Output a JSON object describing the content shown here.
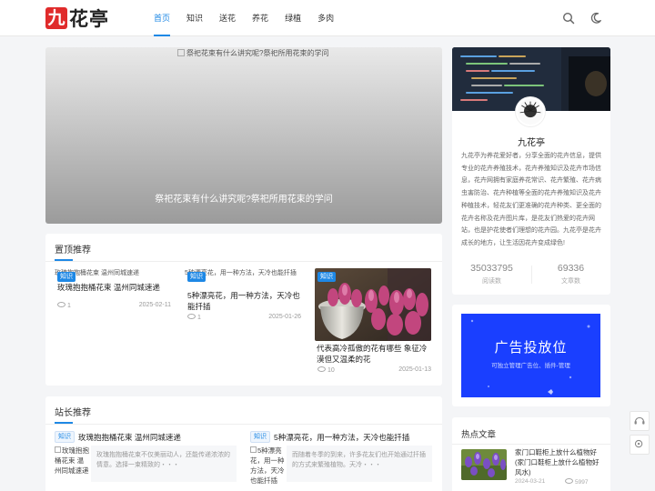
{
  "header": {
    "logo_mark": "九",
    "logo_text": "花亭",
    "nav": [
      "首页",
      "知识",
      "送花",
      "养花",
      "绿植",
      "多肉"
    ],
    "active_nav": 0,
    "icons": [
      "search-icon",
      "moon-icon"
    ]
  },
  "slider": {
    "alt": "祭祀花束有什么讲究呢?祭祀所用花束的学问",
    "title": "祭祀花束有什么讲究呢?祭祀所用花束的学问"
  },
  "top_picks": {
    "title": "置顶推荐",
    "items": [
      {
        "alt": "玫瑰抱抱桶花束 温州同城速递",
        "tag": "知识",
        "title": "玫瑰抱抱桶花束 温州同城速递",
        "views": "1",
        "date": "2025-02-11"
      },
      {
        "alt": "5种漂亮花，用一种方法，天冷也能扦插",
        "tag": "知识",
        "title": "5种漂亮花，用一种方法，天冷也能扦插",
        "views": "1",
        "date": "2025-01-26"
      },
      {
        "tag": "知识",
        "title": "代表高冷孤傲的花有哪些 象征冷漠但又温柔的花",
        "views": "10",
        "date": "2025-01-13"
      }
    ]
  },
  "site_picks": {
    "title": "站长推荐",
    "items": [
      {
        "tag": "知识",
        "title": "玫瑰抱抱桶花束 温州同城速递",
        "thumb_alt": "玫瑰抱抱桶花束 温州同城速递",
        "desc": "玫瑰抱抱桶花束不仅美丽动人，还能传递浓浓的情意。选择一束精致的・・・"
      },
      {
        "tag": "知识",
        "title": "5种漂亮花，用一种方法，天冷也能扦插",
        "thumb_alt": "5种漂亮花，用一种方法，天冷也能扦插",
        "desc": "而随着冬季的到来，许多花友们也开始通过扦插的方式来繁殖植物。天冷・・・"
      }
    ]
  },
  "profile": {
    "name": "九花亭",
    "desc": "九花亭为养花爱好者，分享全面的花卉信息，提供专业的花卉养殖技术，花卉养殖知识及花卉市场信息，花卉网拥有家庭养花常识、花卉繁殖、花卉病虫害防治、花卉种植等全面的花卉养殖知识及花卉种植技术，轻花友们更准确的花卉种类、更全面的花卉名称及花卉图片库，是花友们热爱的花卉网站，也是护花使者们理想的花卉园。九花亭是花卉成长的地方，让生活因花卉变成绿色!",
    "stats": [
      {
        "value": "35033795",
        "label": "阅读数"
      },
      {
        "value": "69336",
        "label": "文章数"
      }
    ]
  },
  "ad": {
    "title": "广告投放位",
    "sub": "可独立管理广告位、插件-管理"
  },
  "hot": {
    "title": "热点文章",
    "items": [
      {
        "title": "家门口鞋柜上放什么植物好(家门口鞋柜上放什么植物好风水)",
        "date": "2024-03-21",
        "views": "5997"
      }
    ]
  },
  "colors": {
    "accent": "#1e88e5",
    "logo_red": "#e02b2b",
    "ad_blue": "#1a3fff"
  }
}
